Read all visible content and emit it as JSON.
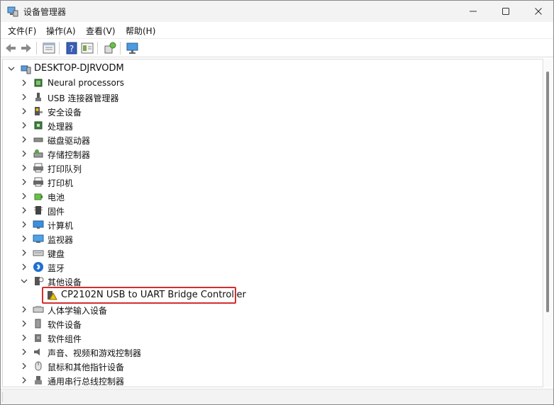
{
  "window": {
    "title": "设备管理器"
  },
  "menu": {
    "file": "文件(F)",
    "action": "操作(A)",
    "view": "查看(V)",
    "help": "帮助(H)"
  },
  "tree": {
    "root": "DESKTOP-DJRVODM",
    "categories": [
      {
        "label": "Neural processors",
        "icon": "chip-icon"
      },
      {
        "label": "USB 连接器管理器",
        "icon": "usb-icon"
      },
      {
        "label": "安全设备",
        "icon": "security-key-icon"
      },
      {
        "label": "处理器",
        "icon": "processor-icon"
      },
      {
        "label": "磁盘驱动器",
        "icon": "disk-drive-icon"
      },
      {
        "label": "存储控制器",
        "icon": "storage-controller-icon"
      },
      {
        "label": "打印队列",
        "icon": "print-queue-icon"
      },
      {
        "label": "打印机",
        "icon": "printer-icon"
      },
      {
        "label": "电池",
        "icon": "battery-icon"
      },
      {
        "label": "固件",
        "icon": "firmware-icon"
      },
      {
        "label": "计算机",
        "icon": "computer-icon"
      },
      {
        "label": "监视器",
        "icon": "monitor-icon"
      },
      {
        "label": "键盘",
        "icon": "keyboard-icon"
      },
      {
        "label": "蓝牙",
        "icon": "bluetooth-icon"
      },
      {
        "label": "其他设备",
        "icon": "unknown-device-icon"
      }
    ],
    "other_device_child": {
      "label": "CP2102N USB to UART Bridge Controller",
      "icon": "warning-device-icon"
    },
    "categories_after": [
      {
        "label": "人体学输入设备",
        "icon": "hid-icon"
      },
      {
        "label": "软件设备",
        "icon": "software-device-icon"
      },
      {
        "label": "软件组件",
        "icon": "software-component-icon"
      },
      {
        "label": "声音、视频和游戏控制器",
        "icon": "speaker-icon"
      },
      {
        "label": "鼠标和其他指针设备",
        "icon": "mouse-icon"
      },
      {
        "label": "通用串行总线控制器",
        "icon": "usb-controller-icon"
      }
    ]
  },
  "colors": {
    "highlight_border": "#d32f2f",
    "warning": "#f2c200"
  }
}
